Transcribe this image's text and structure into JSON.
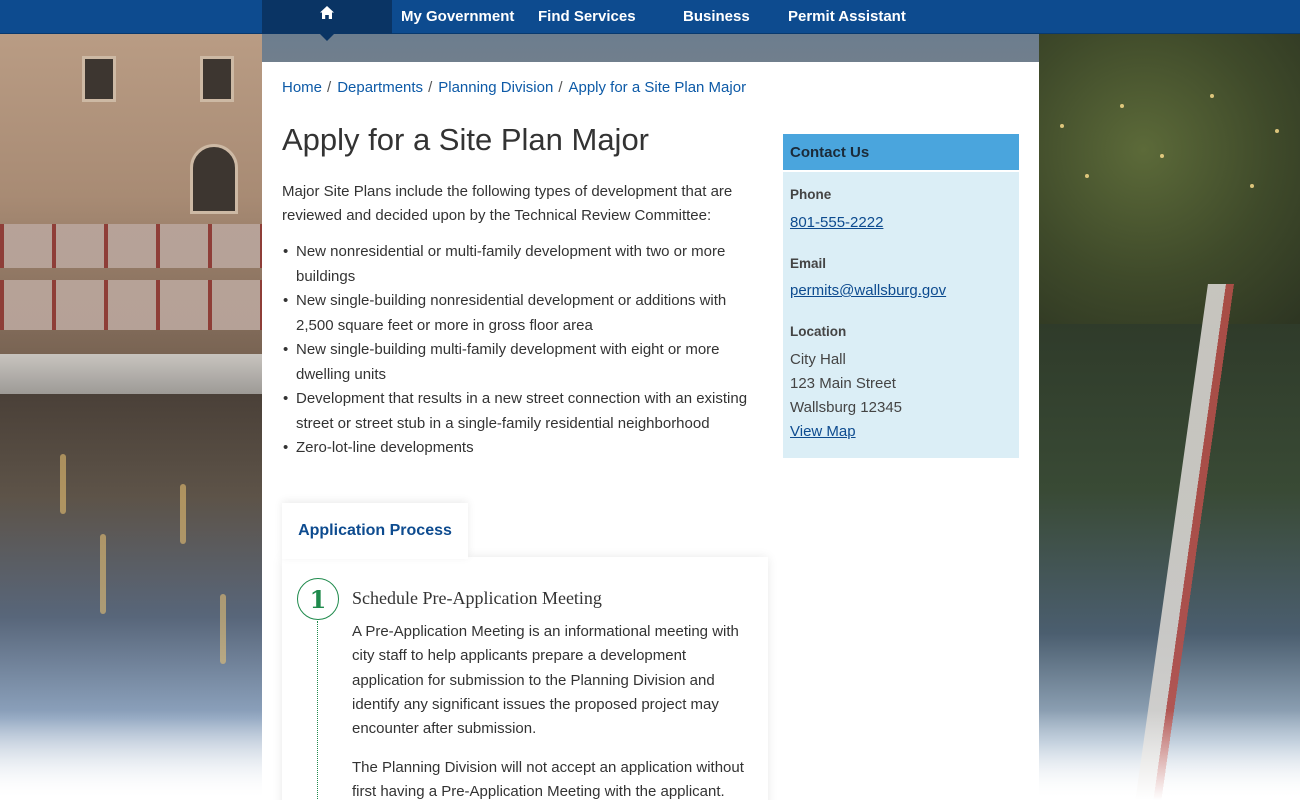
{
  "nav": {
    "items": [
      {
        "label": "My Government"
      },
      {
        "label": "Find Services"
      },
      {
        "label": "Business"
      },
      {
        "label": "Permit Assistant"
      }
    ],
    "home_icon": "home-icon"
  },
  "breadcrumb": {
    "items": [
      {
        "label": "Home"
      },
      {
        "label": "Departments"
      },
      {
        "label": "Planning Division"
      },
      {
        "label": "Apply for a Site Plan Major"
      }
    ],
    "separator": "/"
  },
  "page": {
    "title": "Apply for a Site Plan Major",
    "intro": "Major Site Plans include the following types of development that are reviewed and decided upon by the Technical Review Committee:",
    "bullets": [
      "New nonresidential or multi-family development with two or more buildings",
      "New single-building nonresidential development or additions with 2,500 square feet or more in gross floor area",
      "New single-building multi-family development with eight or more dwelling units",
      "Development that results in a new street connection with an existing street or street stub in a single-family residential neighborhood",
      "Zero-lot-line developments"
    ]
  },
  "process": {
    "tab_label": "Application Process",
    "steps": [
      {
        "number": "1",
        "title": "Schedule Pre-Application Meeting",
        "text": "A Pre-Application Meeting is an informational meeting with city staff to help applicants prepare a development application for submission to the Planning Division and identify any significant issues the proposed project may encounter after submission.",
        "text2": "The Planning Division will not accept an application without first having a Pre-Application Meeting with the applicant."
      }
    ]
  },
  "contact": {
    "heading": "Contact Us",
    "phone_label": "Phone",
    "phone": "801-555-2222",
    "email_label": "Email",
    "email": "permits@wallsburg.gov",
    "location_label": "Location",
    "address_line1": "City Hall",
    "address_line2": "123 Main Street",
    "address_line3": "Wallsburg 12345",
    "map_link": "View Map"
  },
  "colors": {
    "nav_bg": "#0d4b8f",
    "home_bg": "#0a3464",
    "link": "#0d5aa7",
    "contact_head": "#4aa5dd",
    "contact_bg": "#dbeef6",
    "step_green": "#1f8a4c"
  }
}
